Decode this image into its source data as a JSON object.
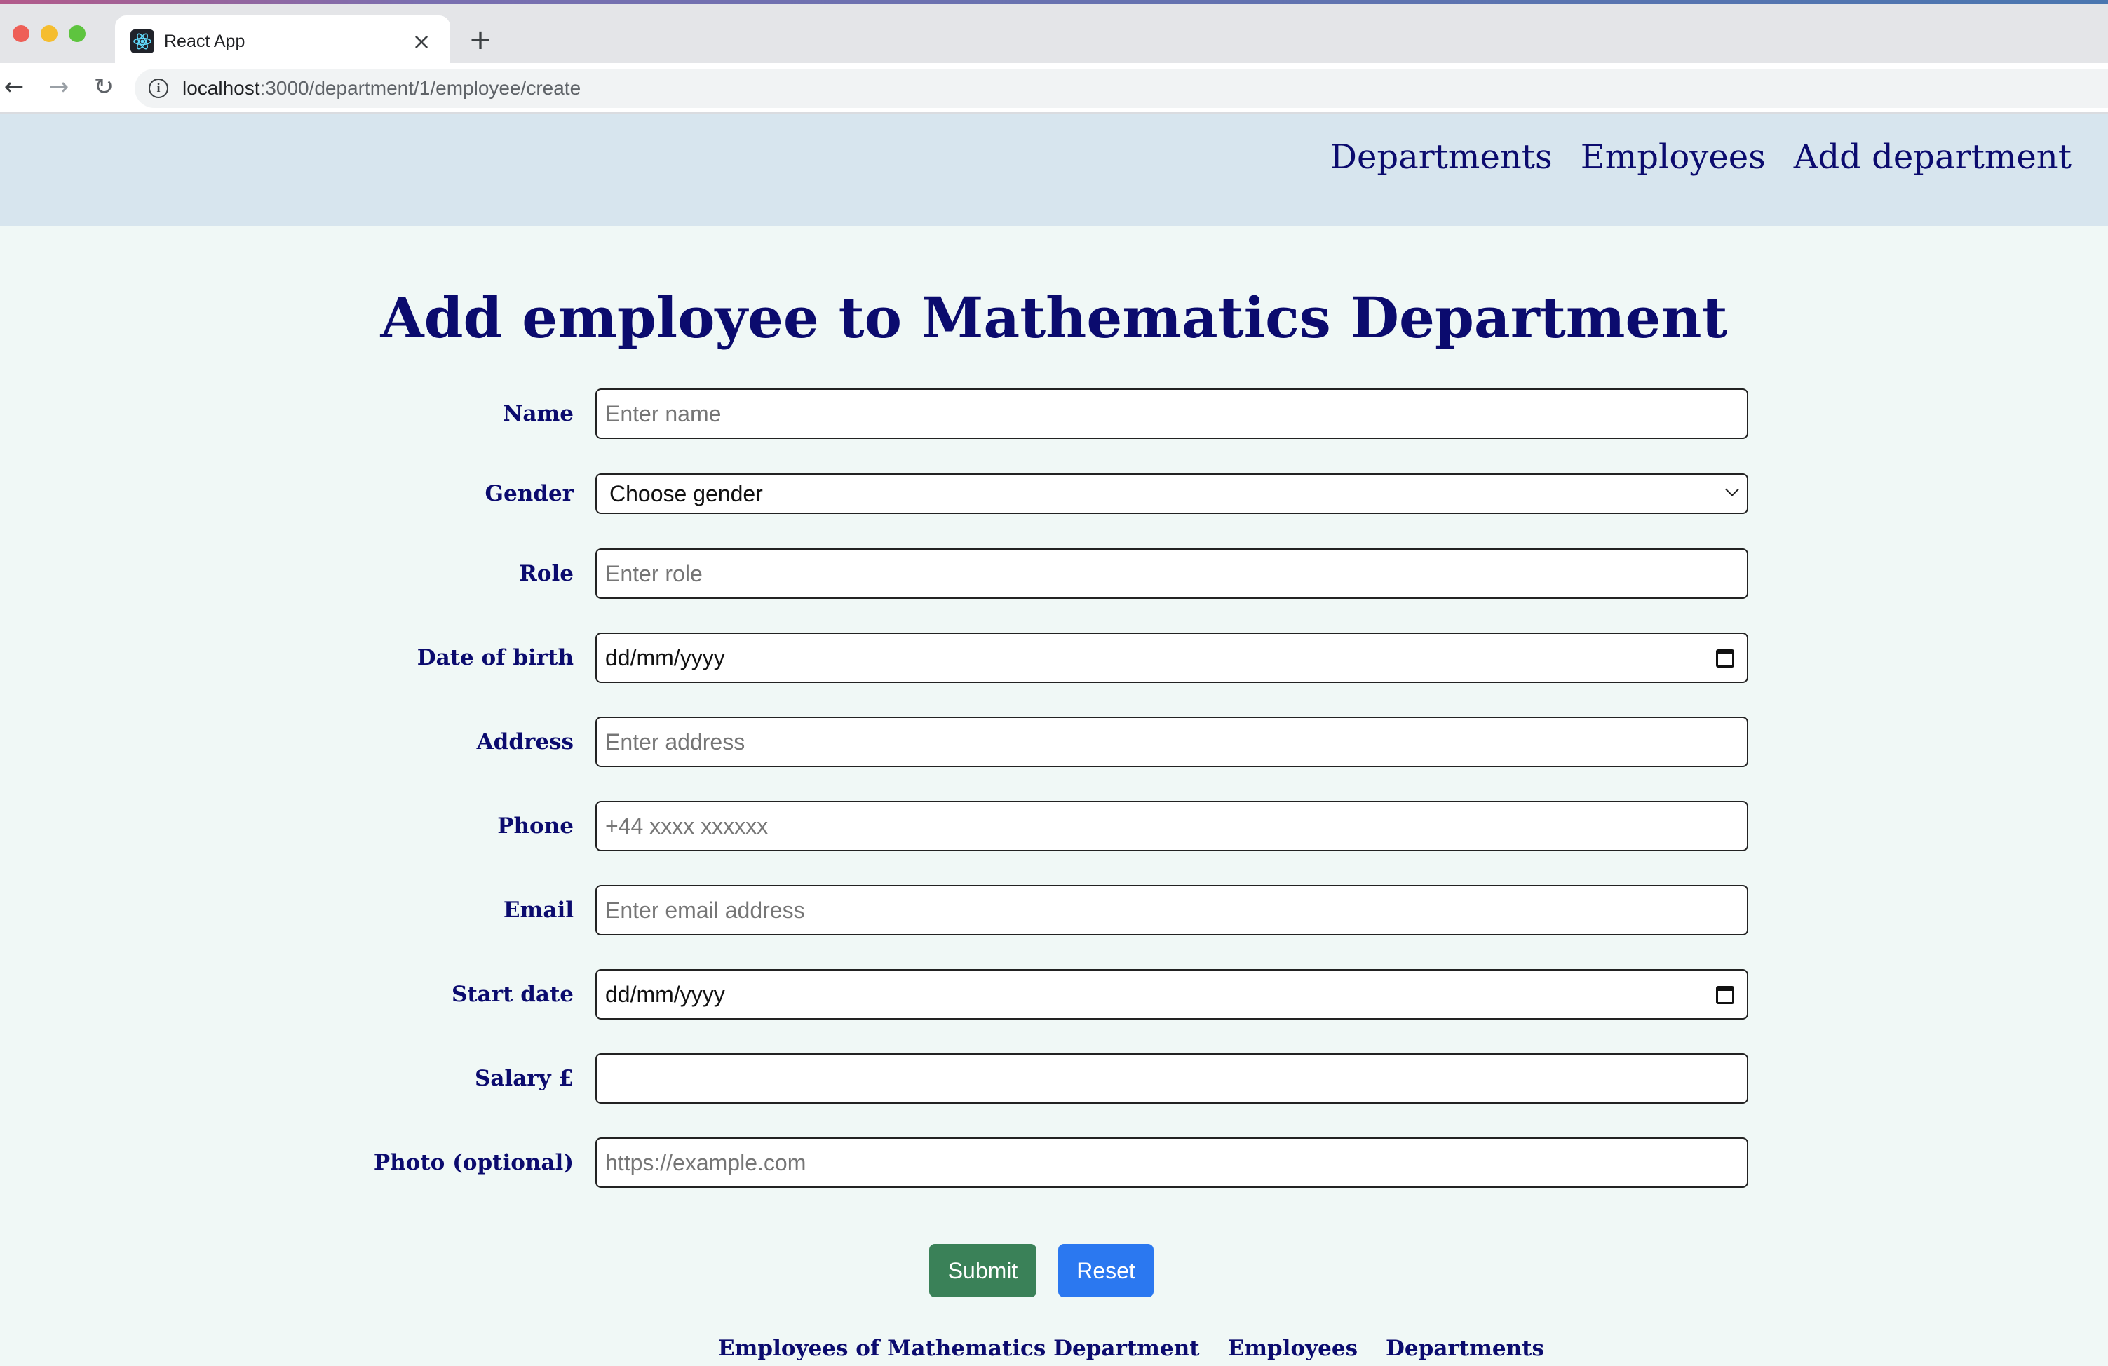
{
  "browser": {
    "tab_title": "React App",
    "url_host": "localhost",
    "url_path": ":3000/department/1/employee/create"
  },
  "nav": {
    "links": [
      "Departments",
      "Employees",
      "Add department"
    ]
  },
  "page": {
    "title": "Add employee to Mathematics Department"
  },
  "form": {
    "fields": [
      {
        "label": "Name",
        "placeholder": "Enter name"
      },
      {
        "label": "Gender",
        "value": "Choose gender"
      },
      {
        "label": "Role",
        "placeholder": "Enter role"
      },
      {
        "label": "Date of birth",
        "value": "dd/mm/yyyy"
      },
      {
        "label": "Address",
        "placeholder": "Enter address"
      },
      {
        "label": "Phone",
        "placeholder": "+44 xxxx xxxxxx"
      },
      {
        "label": "Email",
        "placeholder": "Enter email address"
      },
      {
        "label": "Start date",
        "value": "dd/mm/yyyy"
      },
      {
        "label": "Salary £",
        "placeholder": ""
      },
      {
        "label": "Photo (optional)",
        "placeholder": "https://example.com"
      }
    ],
    "submit_label": "Submit",
    "reset_label": "Reset"
  },
  "footer": {
    "links": [
      "Employees of Mathematics Department",
      "Employees",
      "Departments"
    ]
  },
  "colors": {
    "nav_bg": "#d7e5ee",
    "page_bg": "#f0f8f6",
    "text_navy": "#0b0b6e",
    "submit_green": "#3a8158",
    "reset_blue": "#2b78f0"
  }
}
